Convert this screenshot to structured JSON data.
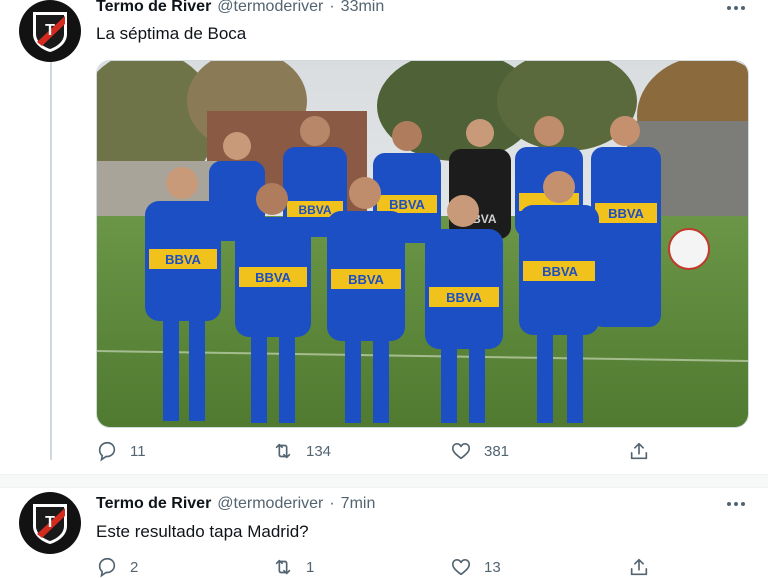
{
  "tweets": [
    {
      "display_name": "Termo de River",
      "handle": "@termoderiver",
      "separator": "·",
      "time": "33min",
      "text": "La séptima de Boca",
      "avatar_icon": "river-logo-icon",
      "photo": {
        "description_icon": "team-photo",
        "shirt_sponsor": "BBVA"
      },
      "actions": {
        "replies": "11",
        "retweets": "134",
        "likes": "381"
      }
    },
    {
      "display_name": "Termo de River",
      "handle": "@termoderiver",
      "separator": "·",
      "time": "7min",
      "text": "Este resultado tapa Madrid?",
      "avatar_icon": "river-logo-icon",
      "actions": {
        "replies": "2",
        "retweets": "1",
        "likes": "13"
      }
    }
  ],
  "colors": {
    "text": "#0f1419",
    "muted": "#536471",
    "shirt_blue": "#1d4fc4",
    "shirt_yellow": "#f2c21c",
    "grass": "#5f8b3a"
  }
}
